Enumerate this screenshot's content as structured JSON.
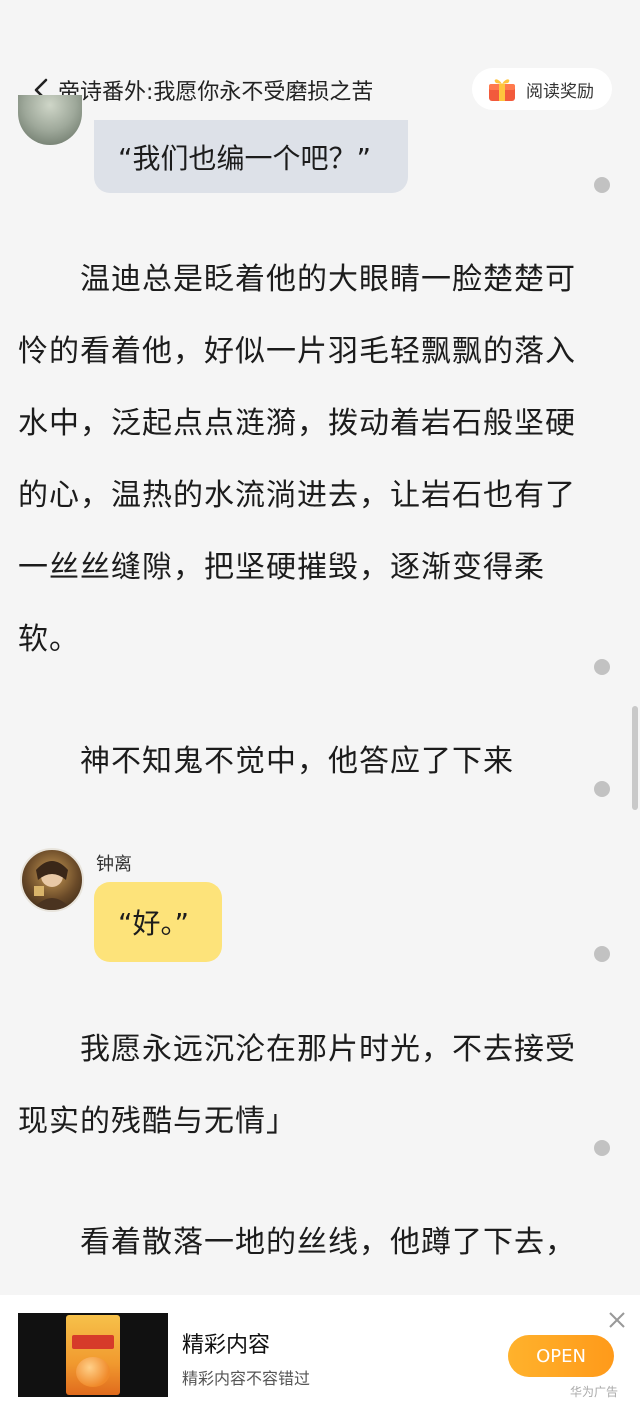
{
  "header": {
    "book_title": "帝诗番外:我愿你永不受磨损之苦",
    "reward_label": "阅读奖励"
  },
  "chat": {
    "bubble_top": "“我们也编一个吧？”",
    "speaker_name": "钟离",
    "bubble_reply": "“好。”"
  },
  "paragraphs": {
    "p1": "温迪总是眨着他的大眼睛一脸楚楚可怜的看着他，好似一片羽毛轻飘飘的落入水中，泛起点点涟漪，拨动着岩石般坚硬的心，温热的水流淌进去，让岩石也有了一丝丝缝隙，把坚硬摧毁，逐渐变得柔软。",
    "p2": "神不知鬼不觉中，他答应了下来",
    "p3": "我愿永远沉沦在那片时光，不去接受现实的残酷与无情」",
    "p4": "看着散落一地的丝线，他蹲了下去，"
  },
  "ad": {
    "title": "精彩内容",
    "subtitle": "精彩内容不容错过",
    "open_label": "OPEN",
    "tag": "华为广告",
    "accent": "#ff9a1a"
  },
  "icons": {
    "back": "chevron-left-icon",
    "reward": "gift-icon",
    "close": "close-icon"
  }
}
